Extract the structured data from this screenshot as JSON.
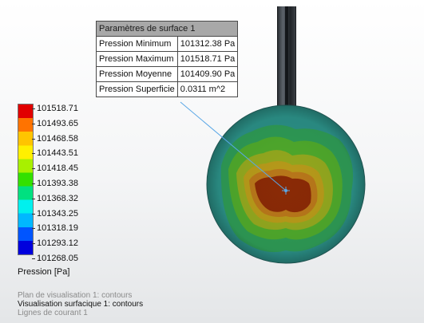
{
  "info_table": {
    "title": "Paramètres de surface 1",
    "rows": [
      {
        "label": "Pression Minimum",
        "value": "101312.38 Pa"
      },
      {
        "label": "Pression Maximum",
        "value": "101518.71 Pa"
      },
      {
        "label": "Pression Moyenne",
        "value": "101409.90 Pa"
      },
      {
        "label": "Pression Superficie",
        "value": "0.0311 m^2"
      }
    ]
  },
  "legend": {
    "labels": [
      "101518.71",
      "101493.65",
      "101468.58",
      "101443.51",
      "101418.45",
      "101393.38",
      "101368.32",
      "101343.25",
      "101318.19",
      "101293.12",
      "101268.05"
    ],
    "unit": "Pression [Pa]",
    "colors": [
      "#e10000",
      "#ff7300",
      "#ffc400",
      "#fff000",
      "#a8f000",
      "#33e000",
      "#00e080",
      "#00f0ee",
      "#00b8ff",
      "#0055ff",
      "#0000dd"
    ]
  },
  "notes": {
    "plane_plot": "Plan de visualisation 1: contours",
    "surface_plot": "Visualisation surfacique 1: contours",
    "flow_lines": "Lignes de courant 1"
  },
  "contour_colors": {
    "outer": "#2b8f86",
    "ring1": "#2e9a55",
    "ring2": "#4fa92c",
    "ring3": "#93a81f",
    "ring4": "#b79a1a",
    "ring5": "#b8771a",
    "core": "#8a2a06",
    "leader": "#5aa7e6"
  }
}
